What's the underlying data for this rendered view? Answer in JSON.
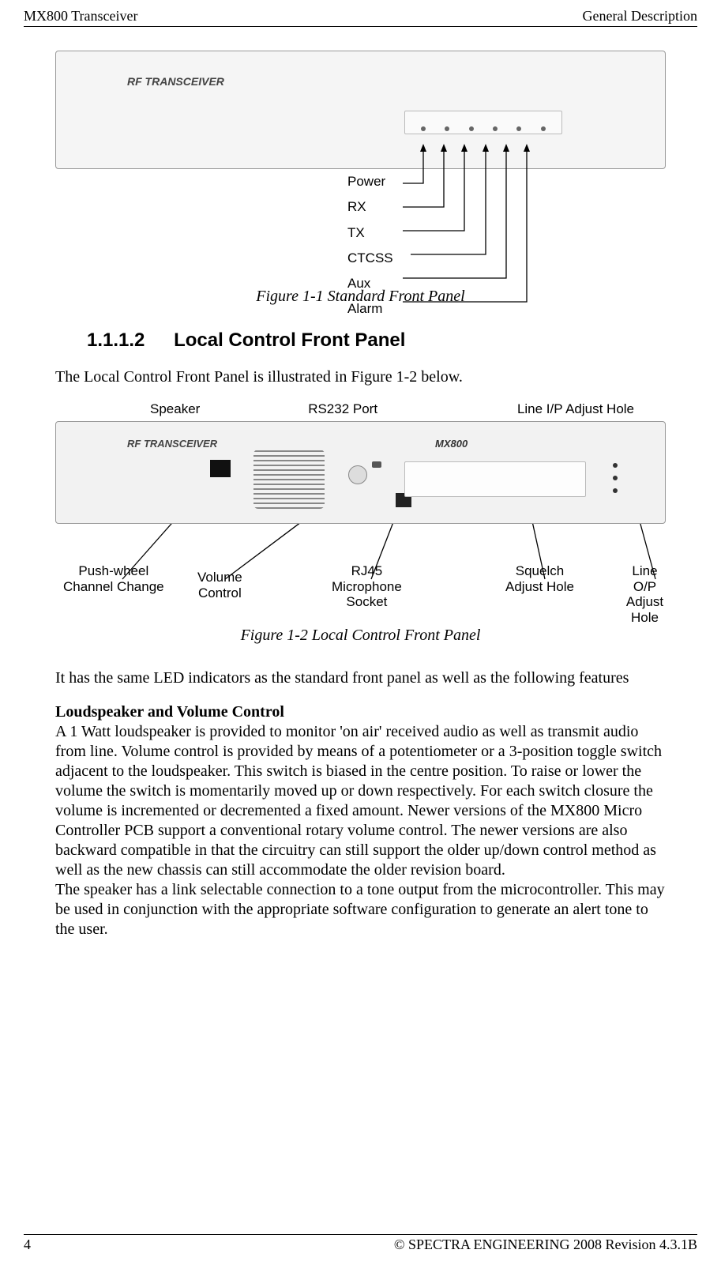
{
  "header": {
    "left": "MX800 Transceiver",
    "right": "General Description"
  },
  "figure1": {
    "brand": "RF TRANSCEIVER",
    "callouts": [
      "Power",
      "RX",
      "TX",
      "CTCSS",
      "Aux",
      "Alarm"
    ],
    "caption": "Figure 1-1  Standard Front Panel"
  },
  "section": {
    "number": "1.1.1.2",
    "title": "Local Control Front Panel",
    "intro": "The Local Control Front Panel is illustrated in Figure 1-2 below."
  },
  "figure2": {
    "top_labels": {
      "speaker": "Speaker",
      "rs232": "RS232 Port",
      "lineip": "Line I/P Adjust Hole"
    },
    "brand": "RF TRANSCEIVER",
    "model": "MX800",
    "bottom_labels": {
      "pushwheel_l1": "Push-wheel",
      "pushwheel_l2": "Channel Change",
      "volume_l1": "Volume",
      "volume_l2": "Control",
      "rj45_l1": "RJ45",
      "rj45_l2": "Microphone",
      "rj45_l3": "Socket",
      "squelch_l1": "Squelch",
      "squelch_l2": "Adjust Hole",
      "lineop_l1": "Line O/P",
      "lineop_l2": "Adjust Hole"
    },
    "caption": "Figure 1-2  Local Control Front Panel"
  },
  "body": {
    "p1": "It has the same LED indicators as the standard front panel as well as the following features",
    "h_loud": "Loudspeaker and Volume Control",
    "p_loud": "A 1 Watt loudspeaker is provided to monitor 'on air' received audio as well as transmit audio from line. Volume control is provided by means of a potentiometer or a 3-position toggle switch adjacent to the loudspeaker. This switch is biased in the centre position. To raise or lower the volume the switch is momentarily moved up or down respectively. For each switch closure the volume is incremented or decremented a fixed amount. Newer versions of the MX800 Micro Controller PCB support a conventional rotary volume control. The newer versions are also backward compatible in that the circuitry can still support the older up/down control method as well as the new chassis can still accommodate the older revision board.",
    "p_speaker": "The speaker has a link selectable connection to a tone output from the microcontroller. This may be used in conjunction with the appropriate software configuration to generate an alert tone to the user."
  },
  "footer": {
    "page": "4",
    "copyright": "© SPECTRA ENGINEERING 2008 Revision 4.3.1B"
  }
}
